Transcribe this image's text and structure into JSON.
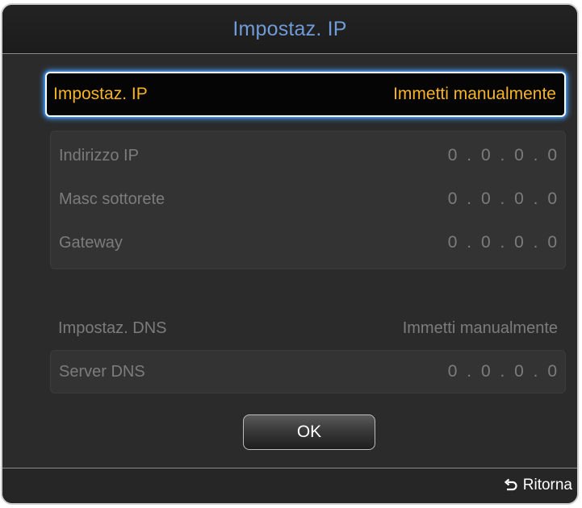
{
  "title": "Impostaz. IP",
  "ip_setting": {
    "label": "Impostaz. IP",
    "value": "Immetti manualmente"
  },
  "ip_fields": [
    {
      "label": "Indirizzo IP",
      "value": "0 . 0 . 0 . 0"
    },
    {
      "label": "Masc sottorete",
      "value": "0 . 0 . 0 . 0"
    },
    {
      "label": "Gateway",
      "value": "0 . 0 . 0 . 0"
    }
  ],
  "dns_setting": {
    "label": "Impostaz. DNS",
    "value": "Immetti manualmente"
  },
  "dns_server": {
    "label": "Server DNS",
    "value": "0 . 0 . 0 . 0"
  },
  "ok_label": "OK",
  "footer": {
    "return_label": "Ritorna",
    "return_icon": "return-arrow-icon"
  },
  "colors": {
    "title": "#6f9bd6",
    "highlight_text": "#f7b423",
    "focus_glow": "#2f8cff",
    "disabled_text": "#7c7c7c"
  }
}
